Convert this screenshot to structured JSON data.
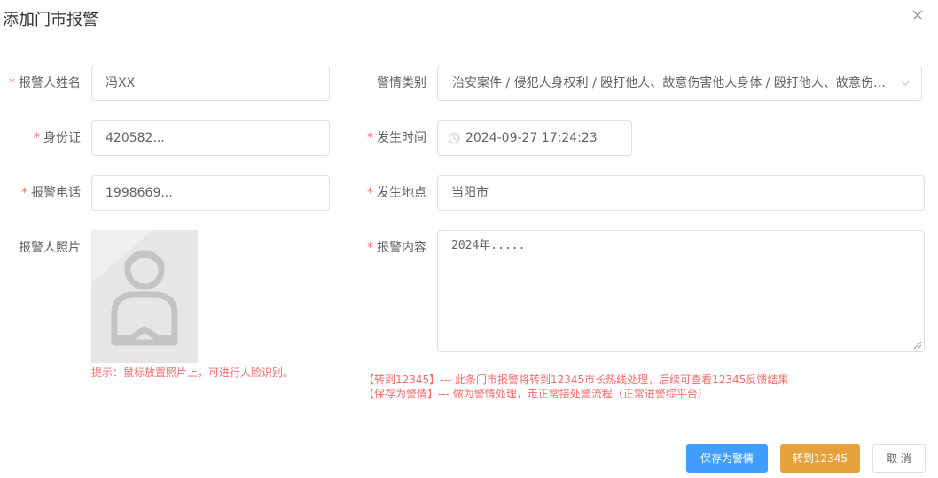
{
  "dialog": {
    "title": "添加门市报警",
    "close_icon": "close-icon"
  },
  "form": {
    "required_mark": "*",
    "reporter_name": {
      "label": "报警人姓名",
      "value": "冯XX",
      "required": true
    },
    "id_card": {
      "label": "身份证",
      "value": "420582...",
      "required": true
    },
    "phone": {
      "label": "报警电话",
      "value": "1998669...",
      "required": true
    },
    "photo": {
      "label": "报警人照片",
      "placeholder_icon": "avatar-placeholder-icon",
      "hint": "提示：鼠标放置照片上，可进行人脸识别。"
    },
    "category": {
      "label": "警情类别",
      "value": "治安案件 / 侵犯人身权利 / 殴打他人、故意伤害他人身体 / 殴打他人、故意伤害他人身体",
      "required": false
    },
    "occur_time": {
      "label": "发生时间",
      "value": "2024-09-27 17:24:23",
      "required": true
    },
    "location": {
      "label": "发生地点",
      "value": "当阳市",
      "required": true
    },
    "content": {
      "label": "报警内容",
      "value": "2024年.....",
      "required": true
    },
    "notes": {
      "line1": "【转到12345】--- 此条门市报警将转到12345市长热线处理，后续可查看12345反馈结果",
      "line2": "【保存为警情】--- 做为警情处理，走正常接处警流程（正常进警综平台）"
    }
  },
  "footer": {
    "save_as_alert": "保存为警情",
    "transfer_12345": "转到12345",
    "cancel": "取 消"
  },
  "colors": {
    "required": "#f56c6c",
    "primary": "#409eff",
    "warning": "#e6a23c",
    "border": "#dcdfe6"
  }
}
